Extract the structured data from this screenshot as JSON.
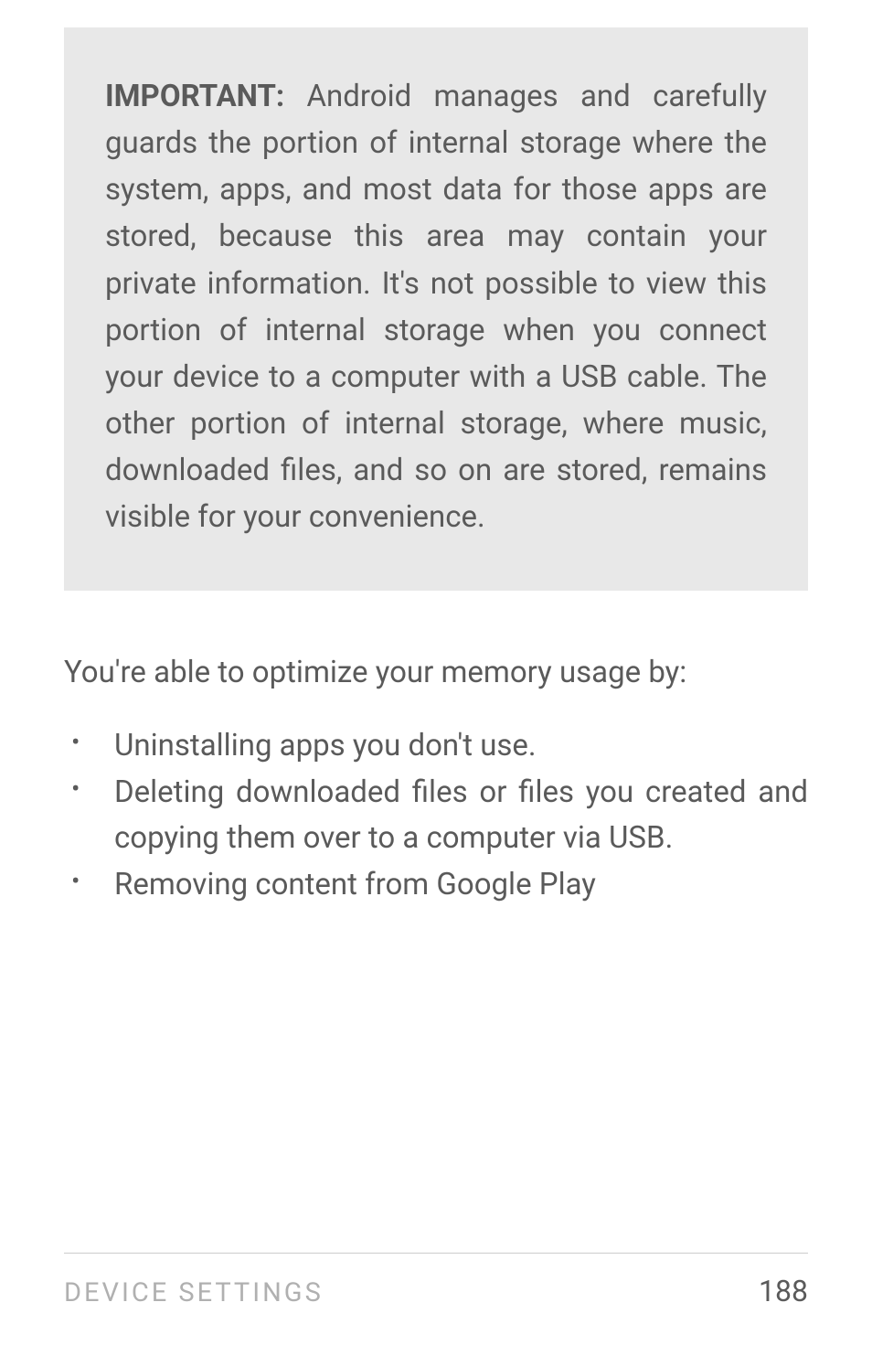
{
  "callout": {
    "label": "IMPORTANT:",
    "text": " Android manages and carefully guards the portion of internal storage where the system, apps, and most data for those apps are stored, because this area may contain your private information. It's not possible to view this portion of internal storage when you connect your device to a computer with a USB cable. The other portion of internal storage, where music, downloaded files, and so on are stored, remains visible for your convenience."
  },
  "intro": "You're able to optimize your memory usage by:",
  "bullets": [
    "Uninstalling apps you don't use.",
    "Deleting downloaded files or files you created and copying them over to a computer via USB.",
    "Removing content from Google Play"
  ],
  "footer": {
    "section": "DEVICE SETTINGS",
    "page": "188"
  }
}
